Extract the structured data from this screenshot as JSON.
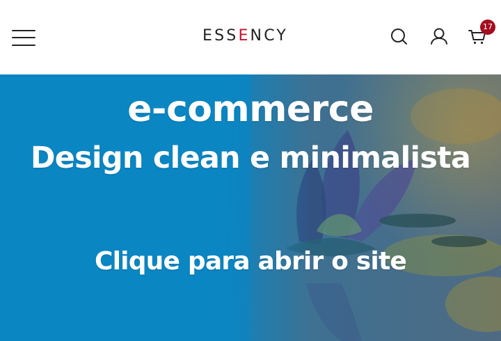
{
  "header": {
    "logo": {
      "part1": "ESS",
      "accent": "E",
      "part2": "NCY"
    },
    "cart_count": "17",
    "icons": [
      "menu-icon",
      "search-icon",
      "user-icon",
      "cart-icon"
    ],
    "accent_color": "#c8102e",
    "badge_color": "#a30d1f"
  },
  "hero": {
    "title": "e-commerce",
    "subtitle": "Design clean e minimalista",
    "cta": "Clique para abrir o site",
    "background_color": "#0a86c3"
  }
}
